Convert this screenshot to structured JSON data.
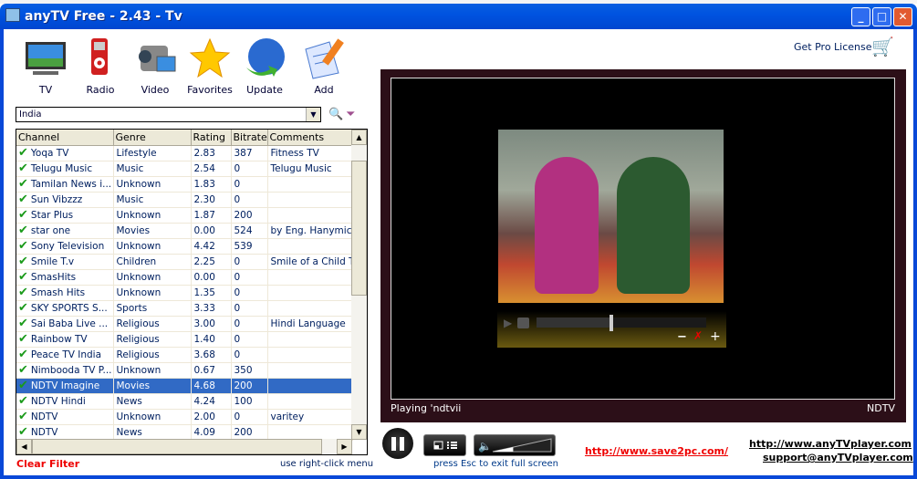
{
  "window": {
    "title": "anyTV Free - 2.43 - Tv",
    "minimize": "_",
    "maximize": "□",
    "close": "✕"
  },
  "toolbar": [
    {
      "label": "TV",
      "icon": "tv-icon"
    },
    {
      "label": "Radio",
      "icon": "radio-icon"
    },
    {
      "label": "Video",
      "icon": "camcorder-icon"
    },
    {
      "label": "Favorites",
      "icon": "star-icon"
    },
    {
      "label": "Update",
      "icon": "globe-icon"
    },
    {
      "label": "Add",
      "icon": "document-pencil-icon"
    }
  ],
  "filter": {
    "country": "India"
  },
  "table": {
    "columns": [
      "Channel",
      "Genre",
      "Rating",
      "Bitrate",
      "Comments"
    ],
    "rows": [
      [
        "Yoqa TV",
        "Lifestyle",
        "2.83",
        "387",
        "Fitness TV"
      ],
      [
        "Telugu Music",
        "Music",
        "2.54",
        "0",
        "Telugu Music"
      ],
      [
        "Tamilan News i...",
        "Unknown",
        "1.83",
        "0",
        ""
      ],
      [
        "Sun Vibzzz",
        "Music",
        "2.30",
        "0",
        ""
      ],
      [
        "Star Plus",
        "Unknown",
        "1.87",
        "200",
        ""
      ],
      [
        "star one",
        "Movies",
        "0.00",
        "524",
        "by Eng. Hanymich"
      ],
      [
        "Sony Television",
        "Unknown",
        "4.42",
        "539",
        ""
      ],
      [
        "Smile T.v",
        "Children",
        "2.25",
        "0",
        "Smile of a Child T."
      ],
      [
        "SmasHits",
        "Unknown",
        "0.00",
        "0",
        ""
      ],
      [
        "Smash Hits",
        "Unknown",
        "1.35",
        "0",
        ""
      ],
      [
        "SKY SPORTS S...",
        "Sports",
        "3.33",
        "0",
        ""
      ],
      [
        "Sai Baba Live ...",
        "Religious",
        "3.00",
        "0",
        "Hindi Language"
      ],
      [
        "Rainbow TV",
        "Religious",
        "1.40",
        "0",
        ""
      ],
      [
        "Peace TV India",
        "Religious",
        "3.68",
        "0",
        ""
      ],
      [
        "Nimbooda TV P...",
        "Unknown",
        "0.67",
        "350",
        ""
      ],
      [
        "NDTV Imagine",
        "Movies",
        "4.68",
        "200",
        ""
      ],
      [
        "NDTV Hindi",
        "News",
        "4.24",
        "100",
        ""
      ],
      [
        "NDTV",
        "Unknown",
        "2.00",
        "0",
        "varitey"
      ],
      [
        "NDTV",
        "News",
        "4.09",
        "200",
        ""
      ]
    ],
    "selected_index": 15
  },
  "footer": {
    "clear_filter": "Clear Filter",
    "hint": "use right-click menu"
  },
  "pro": {
    "label": "Get Pro License"
  },
  "player": {
    "status_left": "Playing 'ndtvii",
    "status_right": "NDTV",
    "seek_fraction": 0.43,
    "volume_fraction": 0.35,
    "minus": "−",
    "plus": "+",
    "mute": "✗"
  },
  "bottom": {
    "esc_hint": "press Esc to exit full screen",
    "save2pc": "http://www.save2pc.com/",
    "site": "http://www.anyTVplayer.com",
    "support": "support@anyTVplayer.com"
  },
  "colors": {
    "selection": "#316ac5",
    "check": "#1a9a1a",
    "clear_filter": "#e00000",
    "titlebar": "#0053e0",
    "video_panel": "#2c0f18"
  }
}
